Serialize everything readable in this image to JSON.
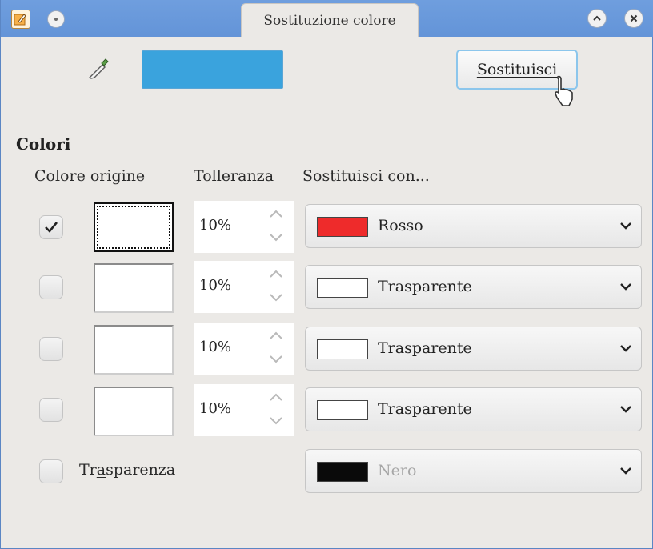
{
  "window": {
    "title": "Sostituzione colore",
    "accent_color": "#6394d8"
  },
  "source": {
    "color": "#3aa3dd",
    "replace_label": "Sostituisci"
  },
  "colors": {
    "section_title": "Colori",
    "headers": {
      "origin": "Colore origine",
      "tolerance": "Tolleranza",
      "replace_with": "Sostituisci con..."
    },
    "rows": [
      {
        "checked": true,
        "tolerance": "10%",
        "target_name": "Rosso",
        "target_color": "#ee2b2b"
      },
      {
        "checked": false,
        "tolerance": "10%",
        "target_name": "Trasparente",
        "target_color": "#ffffff"
      },
      {
        "checked": false,
        "tolerance": "10%",
        "target_name": "Trasparente",
        "target_color": "#ffffff"
      },
      {
        "checked": false,
        "tolerance": "10%",
        "target_name": "Trasparente",
        "target_color": "#ffffff"
      }
    ]
  },
  "transparency": {
    "label_pre": "Tr",
    "label_mnemonic": "a",
    "label_post": "sparenza",
    "checked": false,
    "target_name": "Nero",
    "target_color": "#0a0a0a"
  }
}
